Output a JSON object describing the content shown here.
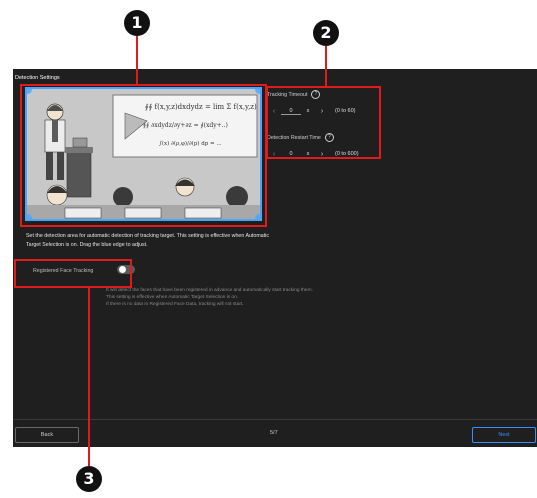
{
  "screen": {
    "title": "Detection Settings",
    "detection_text": "Set the detection area for automatic detection of tracking target. This setting is effective when Automatic Target Selection is on. Drag the blue edge to adjust.",
    "preview": {
      "equations": [
        "∮∮ f(x,y,z)dxdydz = lim Σ f(x,y,z)",
        "∮∮ ∂xdydz/∂y+∂z = ∮(xdy+..)",
        "∫(x) ∂(ρ,φ)/∂(p) dp = ..."
      ],
      "handle_color": "#4aa3ff"
    },
    "face_tracking": {
      "label": "Registered Face Tracking",
      "state": "off",
      "description": [
        "It will detect the faces that have been registered in advance and automatically start tracking them.",
        "This setting is effective when Automatic Target Selection is on.",
        "If there is no data in Registered Face Data, tracking will not start."
      ]
    },
    "tracking_timeout": {
      "label": "Tracking Timeout",
      "help": "?",
      "prev": "‹",
      "value": "0",
      "unit": "s",
      "next": "›",
      "range": "(0 to 60)"
    },
    "detection_restart": {
      "label": "Detection Restart Time",
      "help": "?",
      "prev": "‹",
      "value": "0",
      "unit": "s",
      "next": "›",
      "range": "(0 to 600)"
    },
    "footer": {
      "back_label": "Back",
      "page": "5/7",
      "next_label": "Next"
    }
  },
  "callouts": {
    "c1": "1",
    "c2": "2",
    "c3": "3"
  },
  "colors": {
    "callout_box": "#e01b1b",
    "background": "#1f1f1f",
    "accent": "#3b8cff"
  }
}
